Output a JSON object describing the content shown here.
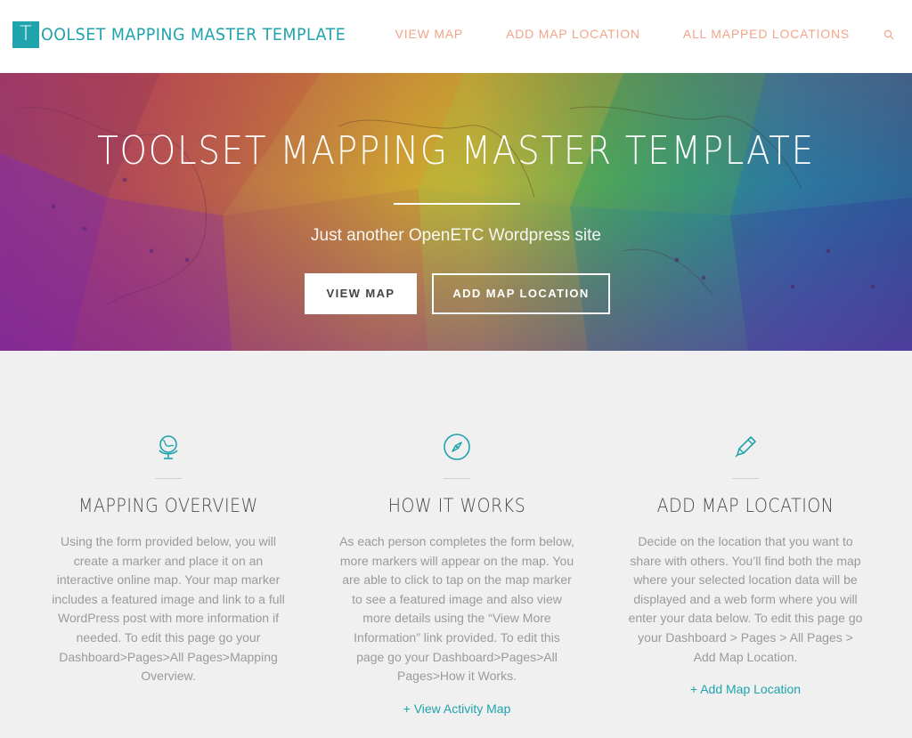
{
  "site": {
    "logo_letter": "T",
    "logo_rest": "OOLSET MAPPING MASTER TEMPLATE"
  },
  "nav": {
    "items": [
      {
        "label": "VIEW MAP"
      },
      {
        "label": "ADD MAP LOCATION"
      },
      {
        "label": "ALL MAPPED LOCATIONS"
      }
    ],
    "search_icon": "search-icon"
  },
  "hero": {
    "title": "TOOLSET MAPPING MASTER TEMPLATE",
    "subtitle": "Just another OpenETC Wordpress site",
    "primary_button": "VIEW MAP",
    "secondary_button": "ADD MAP LOCATION"
  },
  "features": [
    {
      "icon": "globe-icon",
      "title": "MAPPING OVERVIEW",
      "body": "Using the form provided below, you will create a marker and place it on an interactive online map. Your map marker includes a featured image and link to a full WordPress post with more information if needed. To edit this page go your Dashboard>Pages>All Pages>Mapping Overview.",
      "link": ""
    },
    {
      "icon": "compass-icon",
      "title": "HOW IT WORKS",
      "body": "As each person completes the form below, more markers will appear on the map. You are able to click to tap on the map marker to see a featured image and also view more details using the “View More Information” link provided. To edit this page go your Dashboard>Pages>All Pages>How it Works.",
      "link": "+ View Activity Map"
    },
    {
      "icon": "pencil-icon",
      "title": "ADD MAP LOCATION",
      "body": "Decide on the location that you want to share with others. You’ll find both the map where your selected location data will be displayed and a web form where you will enter your data below. To edit this page go your Dashboard > Pages > All Pages > Add Map Location.",
      "link": "+ Add Map Location"
    }
  ],
  "colors": {
    "accent": "#1fa3ad",
    "nav_text": "#f2a58b",
    "body_text": "#9a9a9a",
    "heading_text": "#4a4a4a",
    "section_bg": "#f0f0f0"
  }
}
